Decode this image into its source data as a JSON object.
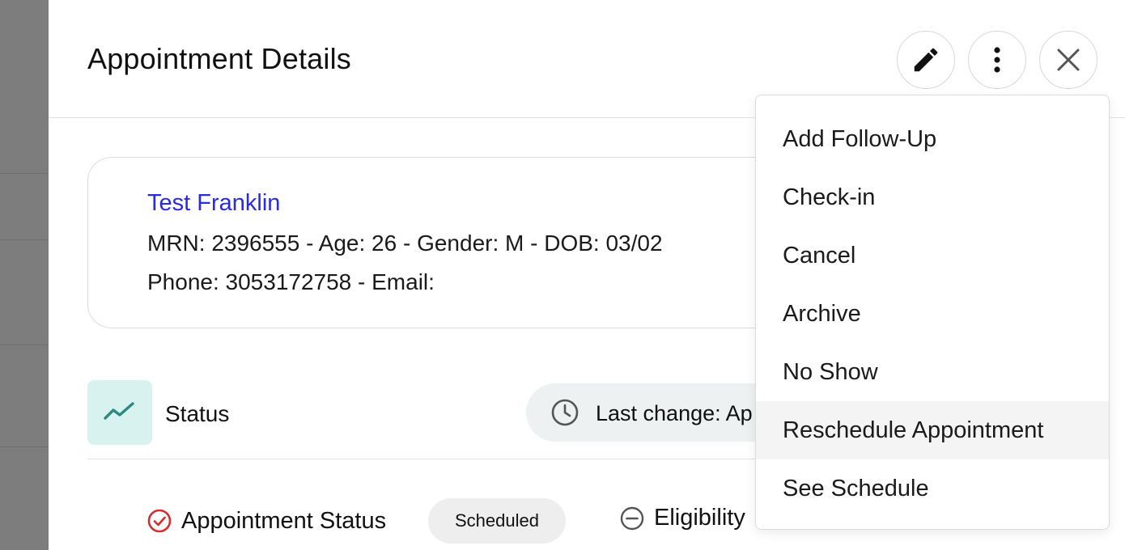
{
  "header": {
    "title": "Appointment Details",
    "buttons": [
      {
        "name": "edit-button",
        "icon": "pencil-icon"
      },
      {
        "name": "more-options-button",
        "icon": "more-vertical-icon"
      },
      {
        "name": "close-button",
        "icon": "close-icon"
      }
    ]
  },
  "patient": {
    "name": "Test Franklin",
    "details_line": "MRN: 2396555 - Age: 26 - Gender: M - DOB: 03/02",
    "contact_line": "Phone: 3053172758 - Email:"
  },
  "status_section": {
    "label": "Status",
    "icon": "trend-line-icon",
    "last_change": "Last change: Ap"
  },
  "appointment_status": {
    "label": "Appointment Status",
    "value": "Scheduled",
    "icon_color": "#d32f2f"
  },
  "eligibility": {
    "label": "Eligibility"
  },
  "menu": {
    "items": [
      {
        "label": "Add Follow-Up"
      },
      {
        "label": "Check-in"
      },
      {
        "label": "Cancel"
      },
      {
        "label": "Archive"
      },
      {
        "label": "No Show"
      },
      {
        "label": "Reschedule Appointment",
        "hovered": true
      },
      {
        "label": "See Schedule"
      }
    ]
  },
  "colors": {
    "link": "#2a2ae0",
    "accent_teal": "#2a8a80",
    "status_icon_bg": "#d8f3ef"
  }
}
